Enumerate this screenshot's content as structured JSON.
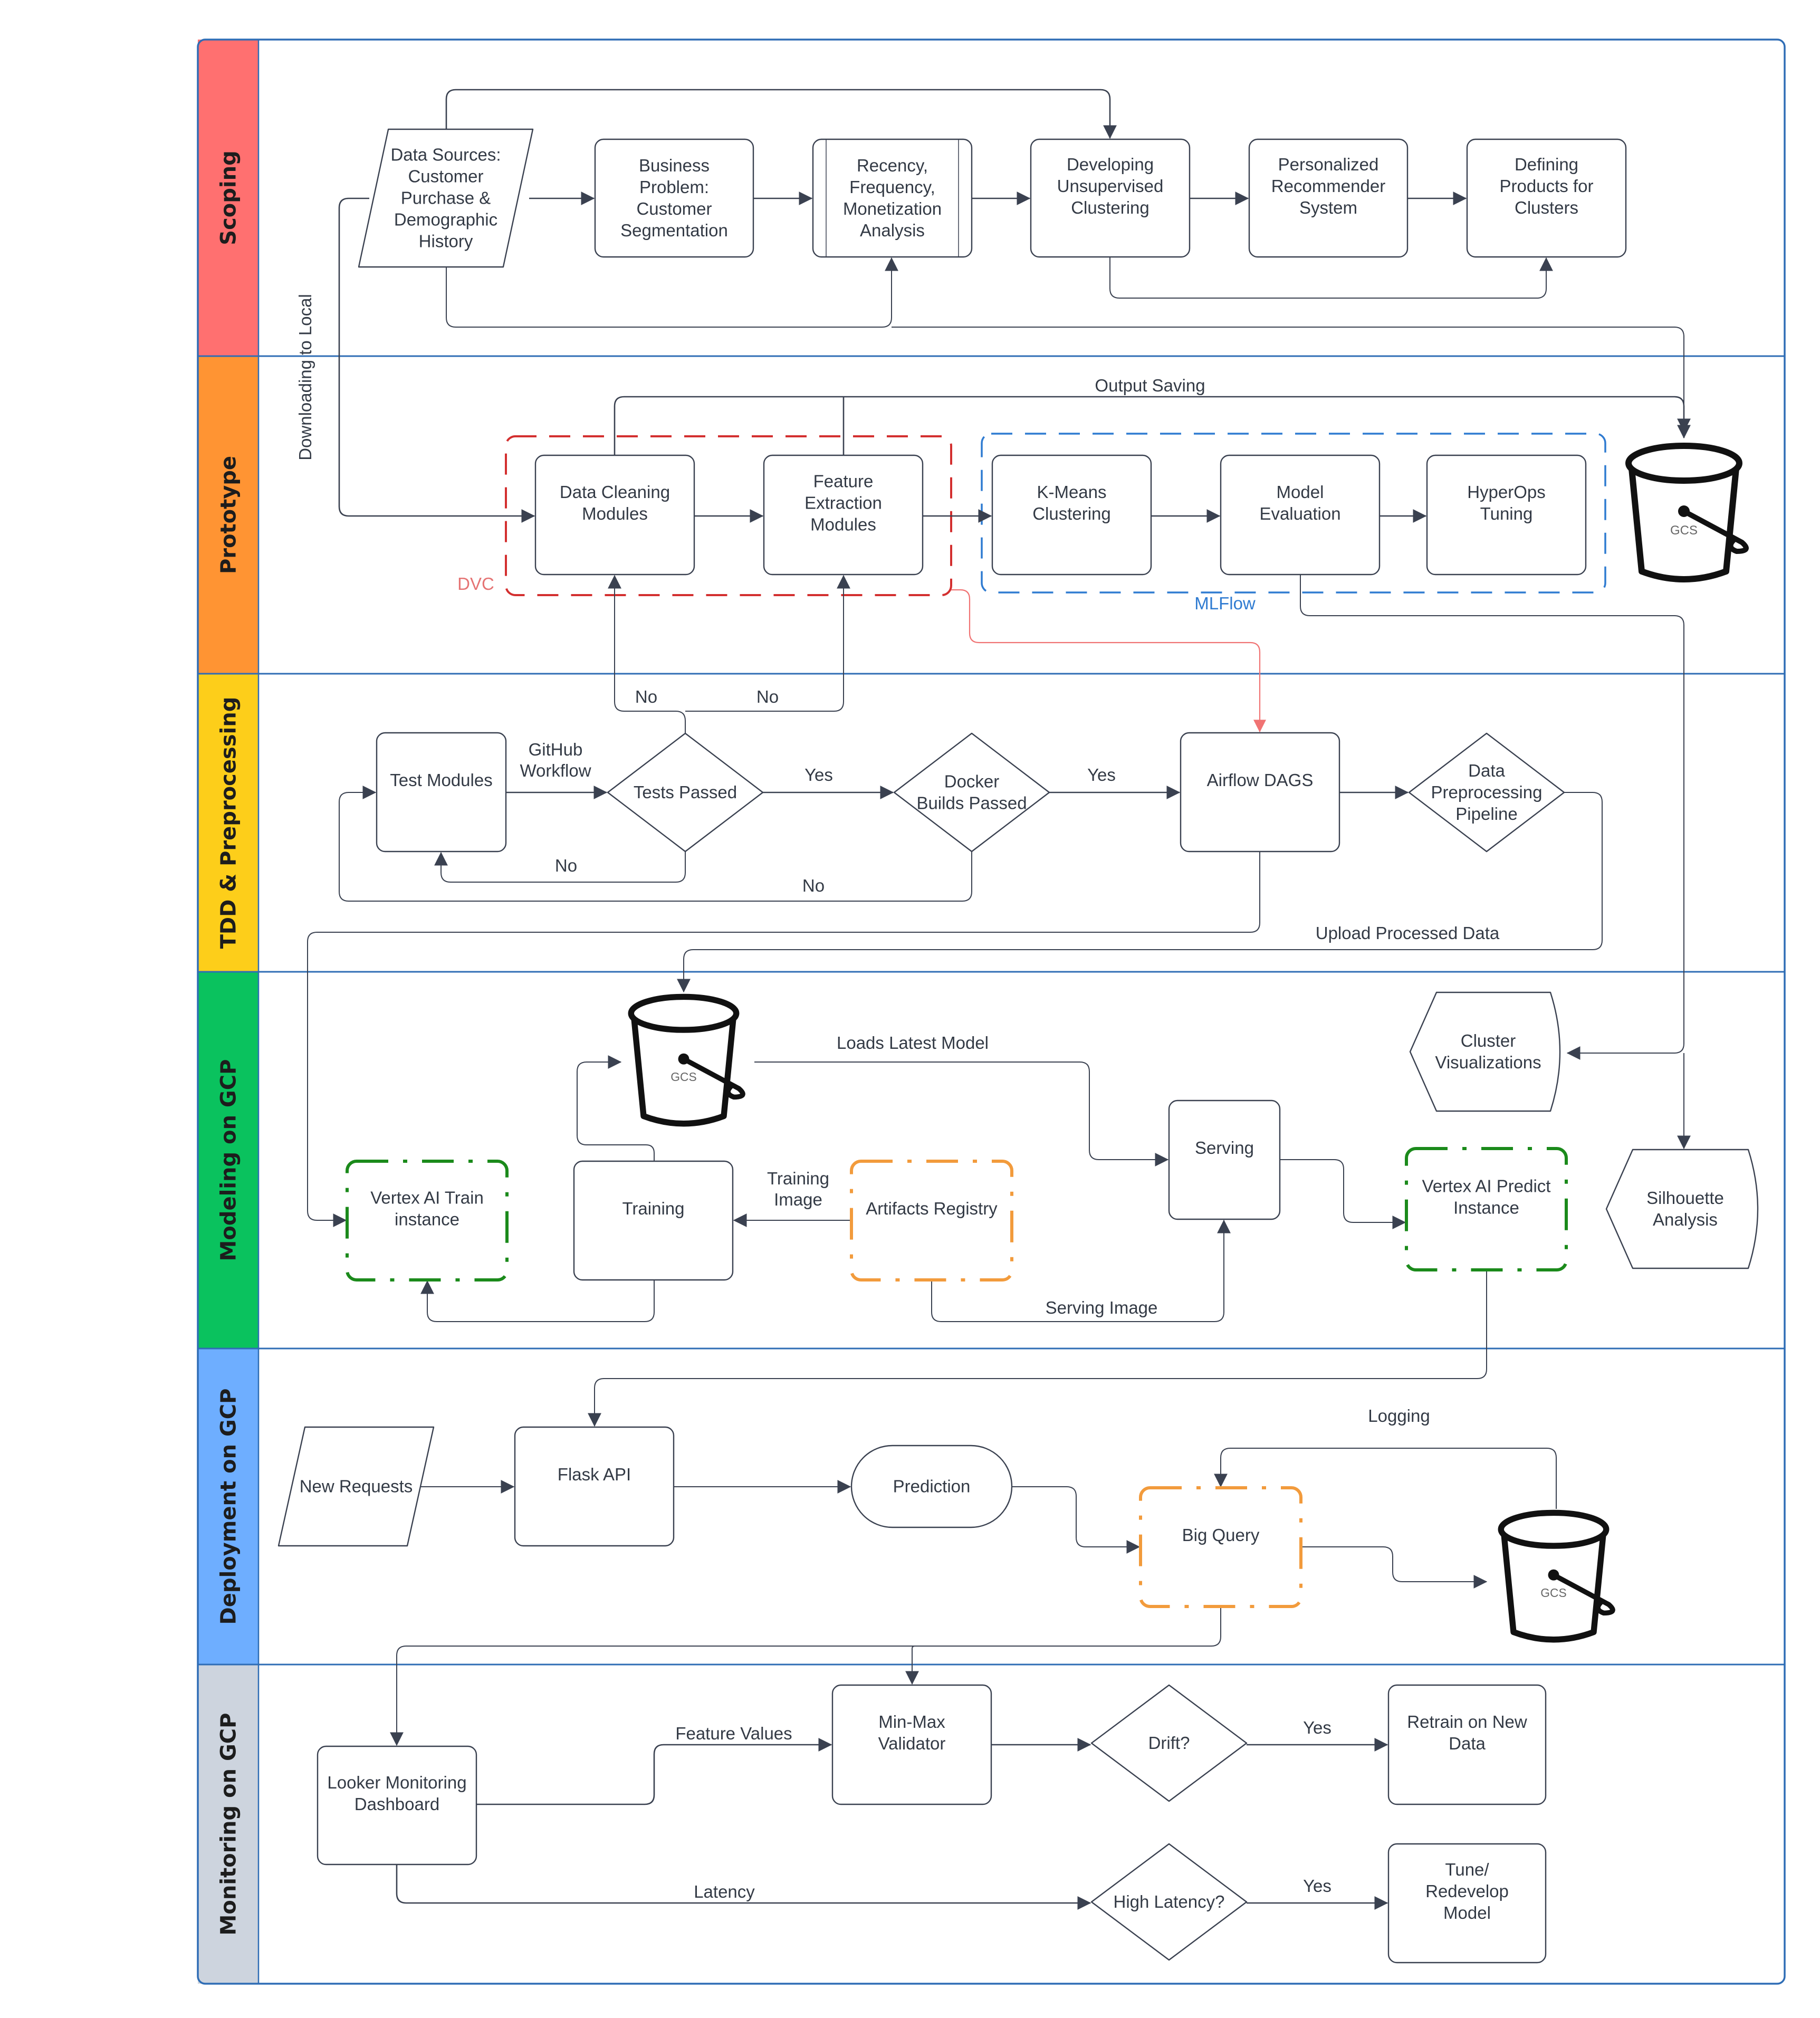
{
  "diagram": {
    "colors": {
      "frame": "#2f6db5",
      "edge": "#3a4150",
      "dvc": "#d32f2f",
      "dvc_label": "#e57373",
      "mlflow": "#2f7bd1",
      "airflow": "#f07373",
      "vertex": "#1b8a1b",
      "artifacts": "#f29b3c",
      "looker": "#2e8b2e",
      "outcome": "#2f7bd1"
    },
    "lanes": [
      {
        "id": "scoping",
        "title": "Scoping",
        "color": "#ff7070"
      },
      {
        "id": "prototype",
        "title": "Prototype",
        "color": "#ff9433"
      },
      {
        "id": "tdd",
        "title": "TDD & Preprocessing",
        "color": "#fdce1a"
      },
      {
        "id": "modeling",
        "title": "Modeling on GCP",
        "color": "#0ac25e"
      },
      {
        "id": "deployment",
        "title": "Deployment on GCP",
        "color": "#6eaeff"
      },
      {
        "id": "monitoring",
        "title": "Monitoring on GCP",
        "color": "#cdd4de"
      }
    ],
    "nodes": {
      "data_sources": {
        "lines": [
          "Data Sources:",
          "Customer",
          "Purchase &",
          "Demographic",
          "History"
        ],
        "shape": "parallelogram"
      },
      "business_problem": {
        "lines": [
          "Business",
          "Problem:",
          "Customer",
          "Segmentation"
        ],
        "shape": "rounded-rect"
      },
      "rfm": {
        "lines": [
          "Recency,",
          "Frequency,",
          "Monetization",
          "Analysis"
        ],
        "shape": "subprocess"
      },
      "unsupervised": {
        "lines": [
          "Developing",
          "Unsupervised",
          "Clustering"
        ],
        "shape": "rounded-rect"
      },
      "recommender": {
        "lines": [
          "Personalized",
          "Recommender",
          "System"
        ],
        "shape": "rounded-rect"
      },
      "defining_products": {
        "lines": [
          "Defining",
          "Products for",
          "Clusters"
        ],
        "shape": "rounded-rect"
      },
      "data_cleaning": {
        "lines": [
          "Data Cleaning",
          "Modules"
        ],
        "shape": "rounded-rect"
      },
      "feature_extraction": {
        "lines": [
          "Feature",
          "Extraction",
          "Modules"
        ],
        "shape": "rounded-rect"
      },
      "kmeans": {
        "lines": [
          "K-Means",
          "Clustering"
        ],
        "shape": "rounded-rect"
      },
      "model_eval": {
        "lines": [
          "Model",
          "Evaluation"
        ],
        "shape": "rounded-rect"
      },
      "hyperops": {
        "lines": [
          "HyperOps",
          "Tuning"
        ],
        "shape": "rounded-rect"
      },
      "test_modules": {
        "lines": [
          "Test Modules"
        ],
        "shape": "rounded-rect"
      },
      "tests_passed": {
        "lines": [
          "Tests Passed"
        ],
        "shape": "diamond"
      },
      "docker_builds": {
        "lines": [
          "Docker",
          "Builds Passed"
        ],
        "shape": "diamond"
      },
      "airflow": {
        "lines": [
          "Airflow DAGS"
        ],
        "shape": "rounded-rect"
      },
      "data_prep": {
        "lines": [
          "Data",
          "Preprocessing",
          "Pipeline"
        ],
        "shape": "diamond"
      },
      "vertex_train": {
        "lines": [
          "Vertex AI Train",
          "instance"
        ],
        "shape": "dash-dot-rect"
      },
      "training": {
        "lines": [
          "Training"
        ],
        "shape": "rounded-rect"
      },
      "artifacts_registry": {
        "lines": [
          "Artifacts Registry"
        ],
        "shape": "dash-dot-rect"
      },
      "serving": {
        "lines": [
          "Serving"
        ],
        "shape": "rounded-rect"
      },
      "vertex_predict": {
        "lines": [
          "Vertex AI Predict",
          "Instance"
        ],
        "shape": "dash-dot-rect"
      },
      "cluster_viz": {
        "lines": [
          "Cluster",
          "Visualizations"
        ],
        "shape": "display"
      },
      "silhouette": {
        "lines": [
          "Silhouette",
          "Analysis"
        ],
        "shape": "display"
      },
      "new_requests": {
        "lines": [
          "New Requests"
        ],
        "shape": "parallelogram"
      },
      "flask_api": {
        "lines": [
          "Flask API"
        ],
        "shape": "rounded-rect"
      },
      "prediction": {
        "lines": [
          "Prediction"
        ],
        "shape": "terminator"
      },
      "big_query": {
        "lines": [
          "Big Query"
        ],
        "shape": "dash-dot-rect"
      },
      "looker": {
        "lines": [
          "Looker Monitoring",
          "Dashboard"
        ],
        "shape": "rounded-rect"
      },
      "minmax": {
        "lines": [
          "Min-Max",
          "Validator"
        ],
        "shape": "rounded-rect"
      },
      "drift": {
        "lines": [
          "Drift?"
        ],
        "shape": "diamond"
      },
      "high_latency": {
        "lines": [
          "High Latency?"
        ],
        "shape": "diamond"
      },
      "retrain": {
        "lines": [
          "Retrain on New",
          "Data"
        ],
        "shape": "rounded-rect"
      },
      "tune": {
        "lines": [
          "Tune/",
          "Redevelop",
          "Model"
        ],
        "shape": "rounded-rect"
      }
    },
    "buckets": {
      "gcs_prototype": {
        "label": "GCS"
      },
      "gcs_modeling": {
        "label": "GCS"
      },
      "gcs_deployment": {
        "label": "GCS"
      }
    },
    "groups": {
      "dvc": {
        "label": "DVC"
      },
      "mlflow": {
        "label": "MLFlow"
      }
    },
    "edge_labels": {
      "downloading_to_local": "Downloading to Local",
      "output_saving": "Output Saving",
      "no_cleaning": "No",
      "no_feature": "No",
      "github_workflow_1": "GitHub",
      "github_workflow_2": "Workflow",
      "yes_tests": "Yes",
      "yes_docker": "Yes",
      "no_tests": "No",
      "no_docker": "No",
      "upload_processed": "Upload Processed Data",
      "loads_latest_model": "Loads Latest Model",
      "training_image_1": "Training",
      "training_image_2": "Image",
      "serving_image": "Serving Image",
      "logging": "Logging",
      "feature_values": "Feature Values",
      "latency": "Latency",
      "yes_drift": "Yes",
      "yes_latency": "Yes"
    }
  }
}
